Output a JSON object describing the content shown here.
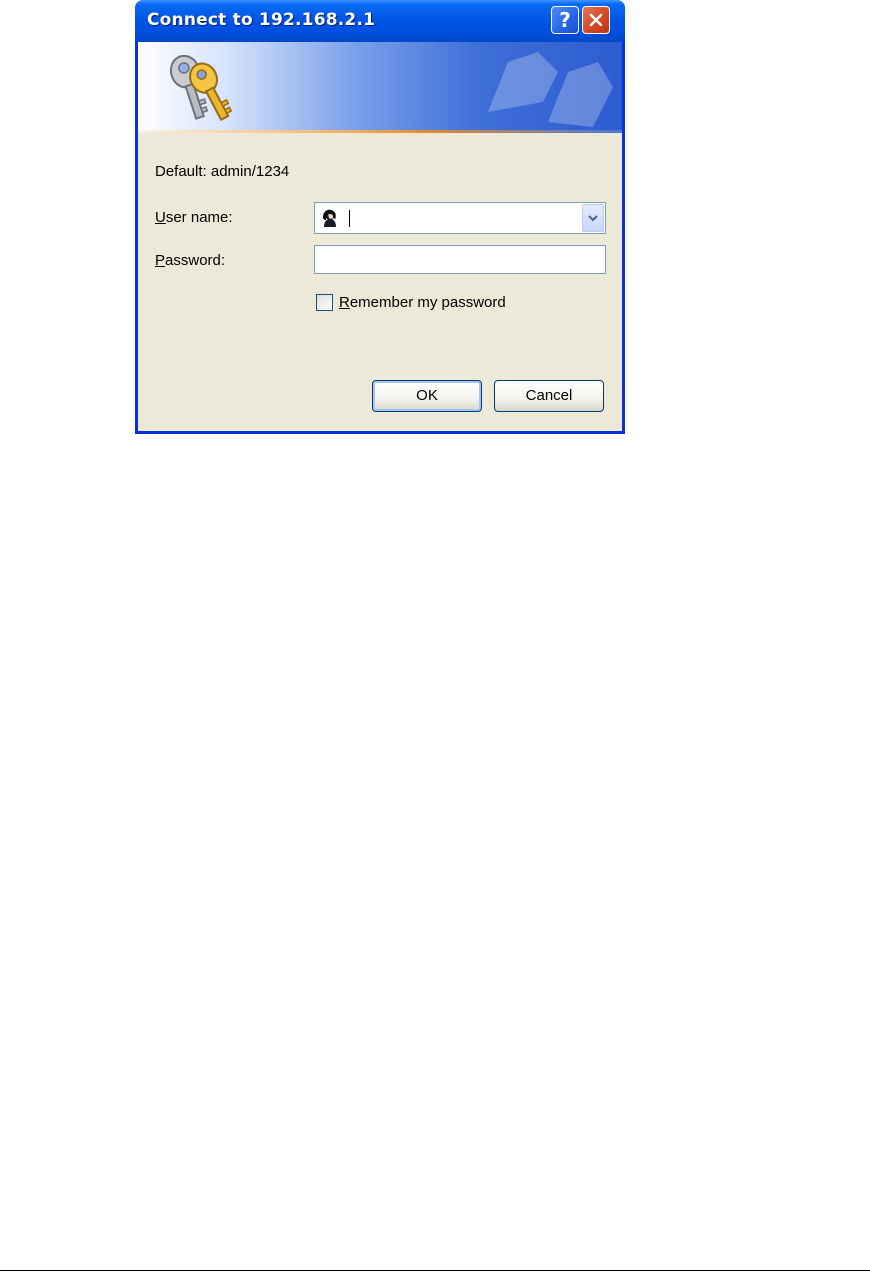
{
  "window": {
    "title": "Connect to 192.168.2.1",
    "help_label": "?",
    "close_icon": "close-icon"
  },
  "banner": {
    "icon": "keys-icon"
  },
  "form": {
    "default_note": "Default: admin/1234",
    "username_label_accel": "U",
    "username_label_rest": "ser name:",
    "username_value": "",
    "password_label_accel": "P",
    "password_label_rest": "assword:",
    "password_value": "",
    "remember_accel": "R",
    "remember_rest": "emember my password",
    "remember_checked": false
  },
  "buttons": {
    "ok_label": "OK",
    "cancel_label": "Cancel"
  },
  "colors": {
    "titlebar": "#0054e3",
    "dialog_body": "#ece9d8",
    "close_button": "#d34a24"
  }
}
